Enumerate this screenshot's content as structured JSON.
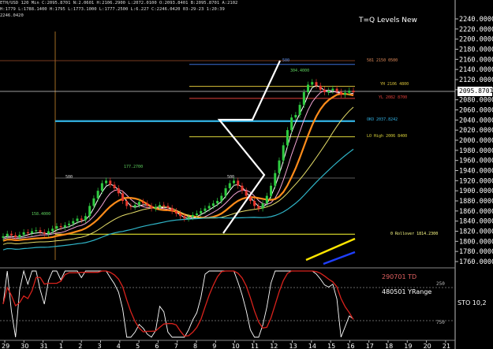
{
  "header": {
    "line1": "ETH/USD 120 Min C:2095.8701 N:2.0601 H:2106.2900 L:2072.0100 O:2093.8401 B:2095.8701 A:2102",
    "line2": "H:1779 L:1788.1400 H:1795 L:1773.1000 L:1777.2500 L:6.227 C:2246.0420 03-29-23 1:20:39",
    "line3": "2246.0420"
  },
  "title": "T=Q Levels New",
  "last_price": "2095.8701",
  "level_labels": {
    "top_581": "581 2150 0500",
    "yh": "YH 2106 4800",
    "yl": "YL 2082 8700",
    "oko": "OKO 2037.8242",
    "lo_high": "LO High 2006 8400",
    "rollover": "0 Rollover 1814.2300",
    "peak_a": "304.4000",
    "mid_a": "177.2700",
    "low_a": "158.4000",
    "lvl_500a": "500",
    "lvl_500b": "500",
    "lvl_500c": "500"
  },
  "oscillator": {
    "td_label": "290701 TD",
    "yrange_label": "480501 YRange",
    "sto_label": "STO 10,2",
    "level_250": "250",
    "level_750": "750"
  },
  "chart_data": {
    "type": "candlestick",
    "title": "T=Q Levels New",
    "symbol": "ETH/USD",
    "timeframe": "120 Min",
    "y_axis_ticks": [
      2240,
      2220,
      2200,
      2180,
      2160,
      2140,
      2120,
      2100,
      2080,
      2060,
      2040,
      2020,
      2000,
      1980,
      1960,
      1940,
      1920,
      1900,
      1880,
      1860,
      1840,
      1820,
      1800,
      1780,
      1760
    ],
    "y_tick_labels": [
      "2240.0000",
      "2220.0000",
      "2200.0000",
      "2180.0000",
      "2160.0000",
      "2140.0000",
      "2120.0000",
      "2100.0000",
      "2080.0000",
      "2060.0000",
      "2040.0000",
      "2020.0000",
      "2000.0000",
      "1980.0000",
      "1960.0000",
      "1940.0000",
      "1920.0000",
      "1900.0000",
      "1880.0000",
      "1860.0000",
      "1840.0000",
      "1820.0000",
      "1800.0000",
      "1780.0000",
      "1760.0000"
    ],
    "ylim": [
      1750,
      2250
    ],
    "x_tick_labels": [
      "29",
      "30",
      "31",
      "1",
      "2",
      "3",
      "4",
      "5",
      "6",
      "7",
      "8",
      "9",
      "10",
      "11",
      "12",
      "13",
      "14",
      "15",
      "16",
      "17",
      "18",
      "19",
      "20",
      "21"
    ],
    "close_series": [
      1810,
      1815,
      1812,
      1808,
      1813,
      1818,
      1816,
      1820,
      1822,
      1818,
      1815,
      1820,
      1825,
      1830,
      1828,
      1832,
      1835,
      1840,
      1845,
      1842,
      1850,
      1870,
      1885,
      1900,
      1915,
      1920,
      1912,
      1905,
      1895,
      1880,
      1870,
      1868,
      1872,
      1878,
      1875,
      1870,
      1865,
      1868,
      1872,
      1870,
      1866,
      1860,
      1855,
      1850,
      1845,
      1848,
      1852,
      1855,
      1860,
      1865,
      1870,
      1875,
      1880,
      1890,
      1905,
      1915,
      1920,
      1910,
      1900,
      1890,
      1880,
      1870,
      1865,
      1875,
      1890,
      1910,
      1935,
      1960,
      1990,
      2020,
      2045,
      2050,
      2070,
      2095,
      2110,
      2115,
      2108,
      2100,
      2095,
      2098,
      2102,
      2096,
      2090,
      2094,
      2098,
      2095
    ],
    "horizontal_levels": [
      {
        "label": "581 2150 0500",
        "value": 2150,
        "color": "#3a6fd8"
      },
      {
        "label": "YH 2106 4800",
        "value": 2106.48,
        "color": "#d9c23a"
      },
      {
        "label": "YL 2082 8700",
        "value": 2082.87,
        "color": "#e0403a"
      },
      {
        "label": "OKO 2037.8242",
        "value": 2037.82,
        "color": "#33b4e6"
      },
      {
        "label": "LO High 2006 8400",
        "value": 2006.84,
        "color": "#d9d23a"
      },
      {
        "label": "0 Rollover 1814.2300",
        "value": 1814.23,
        "color": "#ffff33"
      }
    ],
    "oscillator": {
      "name": "STO 10,2",
      "levels": [
        250,
        750
      ]
    },
    "grid": false
  }
}
